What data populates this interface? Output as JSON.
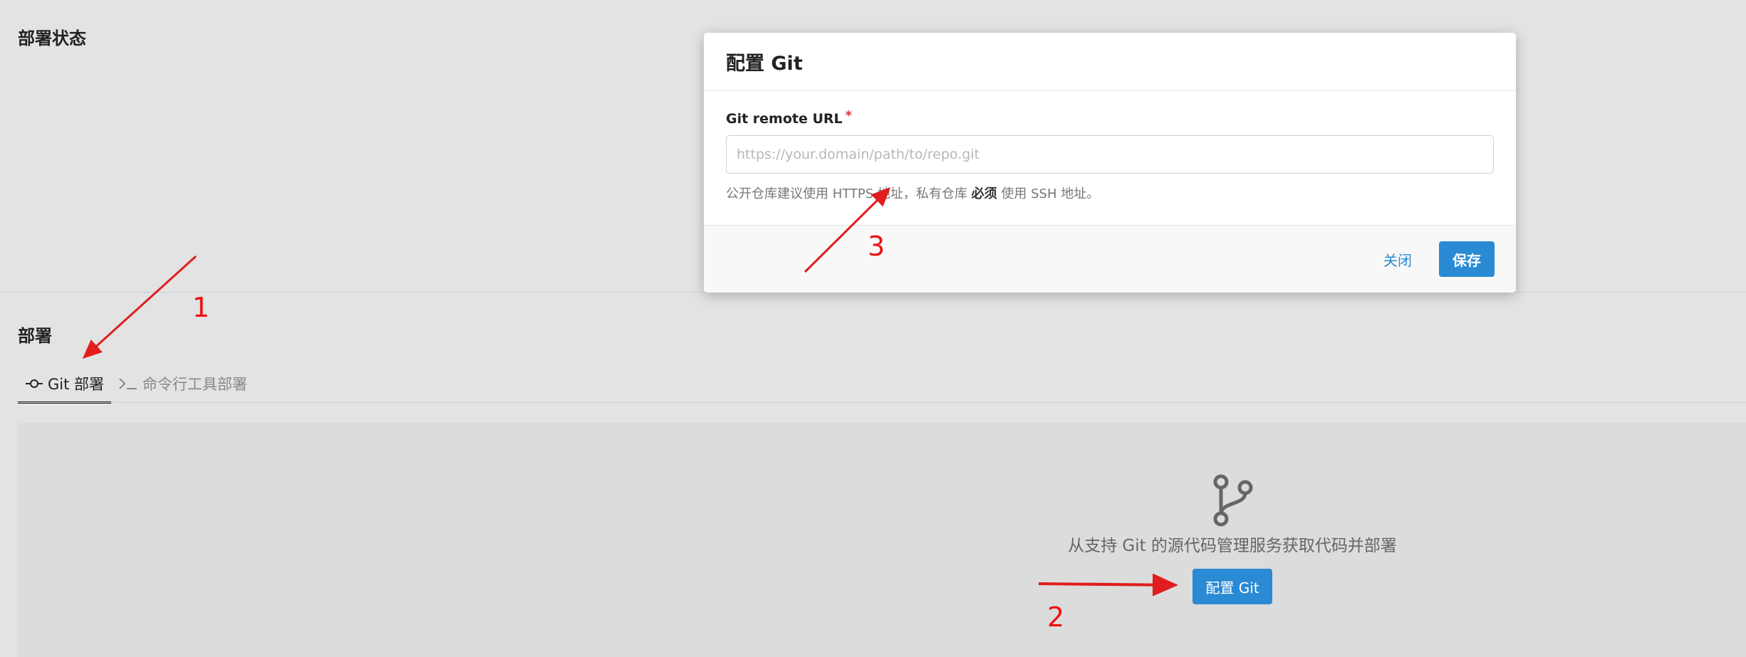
{
  "sections": {
    "status_title": "部署状态",
    "deploy_title": "部署"
  },
  "tabs": [
    {
      "label": "Git 部署",
      "icon": "git-commit-icon",
      "active": true
    },
    {
      "label": "命令行工具部署",
      "icon": "terminal-icon",
      "active": false
    }
  ],
  "empty_state": {
    "icon": "git-branch-icon",
    "text": "从支持 Git 的源代码管理服务获取代码并部署",
    "button_label": "配置 Git"
  },
  "modal": {
    "title": "配置 Git",
    "field_label": "Git remote URL",
    "required_mark": "*",
    "input_placeholder": "https://your.domain/path/to/repo.git",
    "input_value": "",
    "help_prefix": "公开仓库建议使用 HTTPS 地址，私有仓库 ",
    "help_emphasis": "必须",
    "help_suffix": " 使用 SSH 地址。",
    "close_label": "关闭",
    "save_label": "保存"
  },
  "annotations": {
    "label_1": "1",
    "label_2": "2",
    "label_3": "3",
    "color": "#e11d1d"
  },
  "colors": {
    "primary": "#2a8ad4",
    "background": "#e3e3e3"
  }
}
